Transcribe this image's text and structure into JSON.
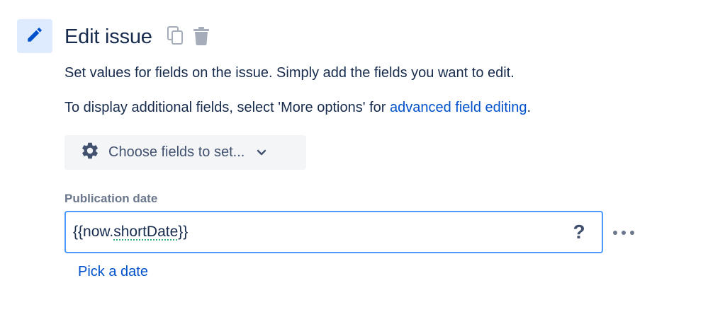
{
  "header": {
    "title": "Edit issue",
    "icon": "pencil-icon",
    "actions": [
      {
        "name": "copy-icon"
      },
      {
        "name": "trash-icon"
      }
    ]
  },
  "description": {
    "line1": "Set values for fields on the issue. Simply add the fields you want to edit.",
    "line2_prefix": "To display additional fields, select 'More options' for ",
    "line2_link": "advanced field editing",
    "line2_suffix": "."
  },
  "choose_fields": {
    "label": "Choose fields to set...",
    "icon": "gear-icon",
    "chevron": "chevron-down-icon"
  },
  "field": {
    "label": "Publication date",
    "value_prefix": "{{now.",
    "value_underlined": "shortDate",
    "value_suffix": "}}",
    "help": "?",
    "more": "more-icon"
  },
  "pick_date": "Pick a date",
  "colors": {
    "accent": "#0052cc",
    "text": "#172b4d",
    "muted": "#6b778c",
    "focus_border": "#4c9aff",
    "icon_tile": "#deebff"
  }
}
